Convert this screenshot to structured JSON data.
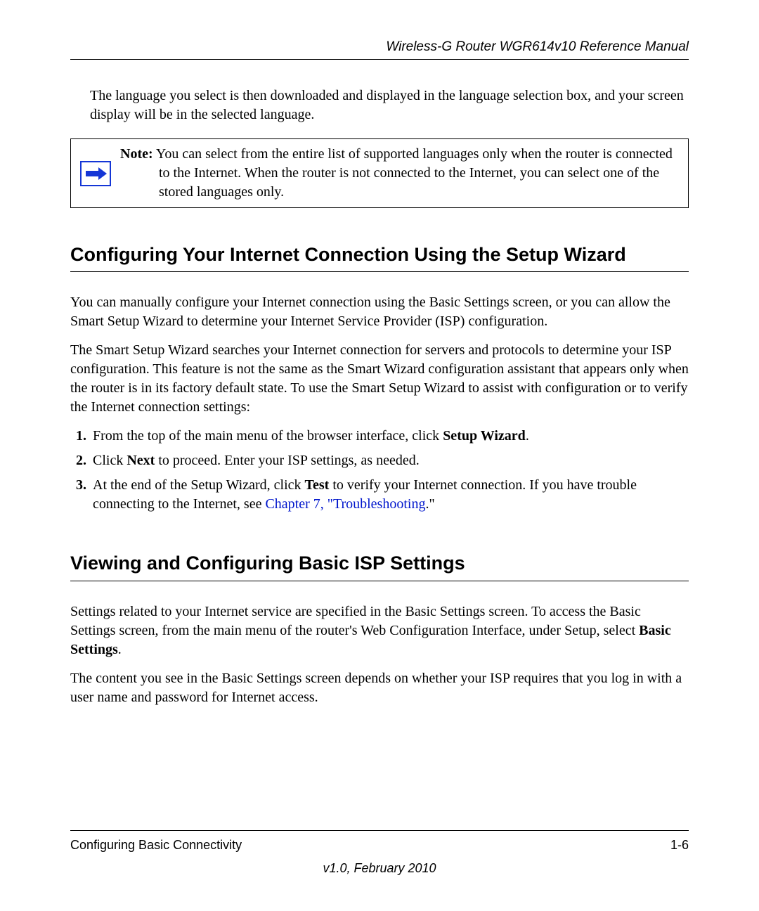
{
  "header": {
    "title": "Wireless-G Router WGR614v10 Reference Manual"
  },
  "intro_paragraph": "The language you select is then downloaded and displayed in the language selection box, and your screen display will be in the selected language.",
  "note": {
    "label": "Note:",
    "text": "You can select from the entire list of supported languages only when the router is connected to the Internet. When the router is not connected to the Internet, you can select one of the stored languages only."
  },
  "section1": {
    "heading": "Configuring Your Internet Connection Using the Setup Wizard",
    "para1": "You can manually configure your Internet connection using the Basic Settings screen, or you can allow the Smart Setup Wizard to determine your Internet Service Provider (ISP) configuration.",
    "para2": "The Smart Setup Wizard searches your Internet connection for servers and protocols to determine your ISP configuration. This feature is not the same as the Smart Wizard configuration assistant that appears only when the router is in its factory default state. To use the Smart Setup Wizard to assist with configuration or to verify the Internet connection settings:",
    "steps": {
      "s1_a": "From the top of the main menu of the browser interface, click ",
      "s1_b": "Setup Wizard",
      "s1_c": ".",
      "s2_a": "Click ",
      "s2_b": "Next",
      "s2_c": " to proceed. Enter your ISP settings, as needed.",
      "s3_a": "At the end of the Setup Wizard, click ",
      "s3_b": "Test",
      "s3_c": " to verify your Internet connection. If you have trouble connecting to the Internet, see ",
      "s3_link": "Chapter 7, \"Troubleshooting",
      "s3_d": ".\""
    }
  },
  "section2": {
    "heading": "Viewing and Configuring Basic ISP Settings",
    "para1_a": "Settings related to your Internet service are specified in the Basic Settings screen. To access the Basic Settings screen, from the main menu of the router's Web Configuration Interface, under Setup, select ",
    "para1_b": "Basic Settings",
    "para1_c": ".",
    "para2": "The content you see in the Basic Settings screen depends on whether your ISP requires that you log in with a user name and password for Internet access."
  },
  "footer": {
    "section": "Configuring Basic Connectivity",
    "page": "1-6",
    "version": "v1.0, February 2010"
  }
}
